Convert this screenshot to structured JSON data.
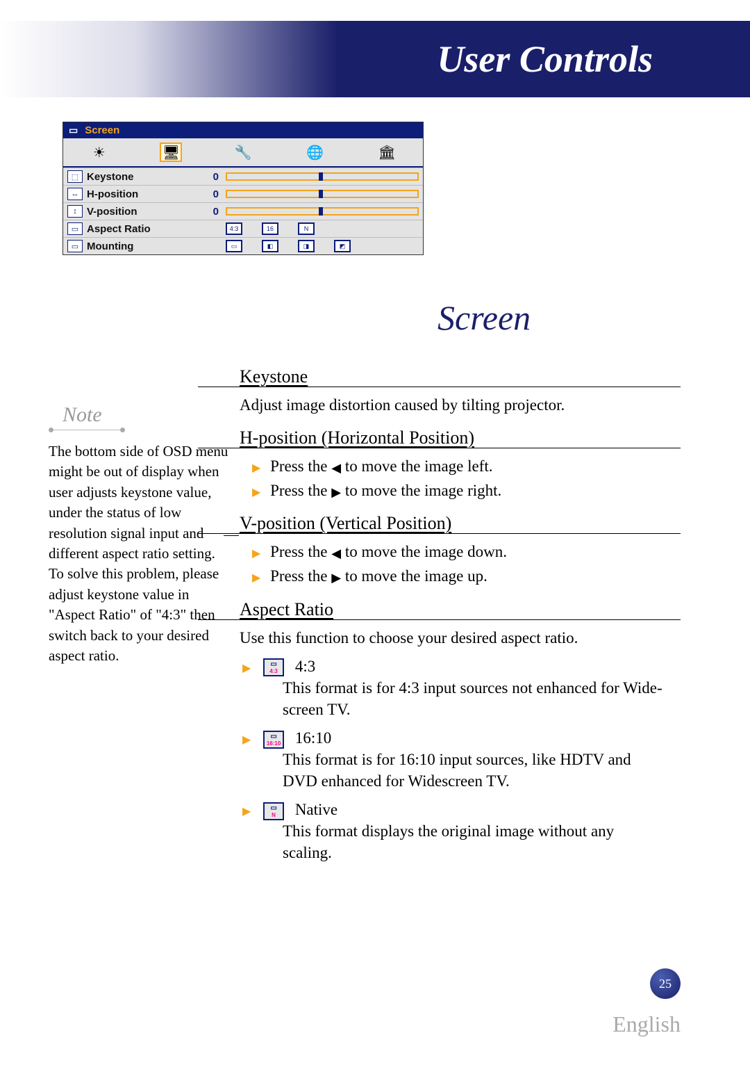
{
  "header": {
    "title": "User Controls"
  },
  "osd": {
    "title": "Screen",
    "tabs": [
      "🔆",
      "🖥",
      "🛠",
      "🌐",
      "🏛"
    ],
    "rows": {
      "keystone": {
        "label": "Keystone",
        "value": "0"
      },
      "hpos": {
        "label": "H-position",
        "value": "0"
      },
      "vpos": {
        "label": "V-position",
        "value": "0"
      },
      "aspect": {
        "label": "Aspect Ratio"
      },
      "mount": {
        "label": "Mounting"
      }
    }
  },
  "section_title": "Screen",
  "keystone": {
    "heading": "Keystone",
    "body": "Adjust image distortion caused by tilting projector."
  },
  "hpos": {
    "heading": "H-position (Horizontal Position)",
    "b1a": "Press the ",
    "b1b": " to move the image left.",
    "b2a": "Press the ",
    "b2b": " to move the image right."
  },
  "vpos": {
    "heading": "V-position (Vertical Position)",
    "b1a": "Press the ",
    "b1b": " to move the image down.",
    "b2a": "Press the ",
    "b2b": " to move the image up."
  },
  "aspect": {
    "heading": "Aspect Ratio",
    "intro": "Use this function to choose your desired aspect ratio.",
    "items": [
      {
        "label": "4:3",
        "desc": "This format is for 4:3 input sources not enhanced for Wide-screen TV."
      },
      {
        "label": "16:10",
        "desc": "This format is for 16:10 input sources, like HDTV and DVD enhanced for Widescreen TV."
      },
      {
        "label": "Native",
        "desc": "This format displays the original image without any scaling."
      }
    ]
  },
  "note": {
    "label": "Note",
    "text": "The bottom side of OSD menu might be out of display when user adjusts keystone value, under the status of low resolution signal input and different aspect ratio setting. To solve this problem, please adjust keystone value in \"Aspect Ratio\" of \"4:3\" then switch back to your desired aspect ratio."
  },
  "page_number": "25",
  "language": "English"
}
